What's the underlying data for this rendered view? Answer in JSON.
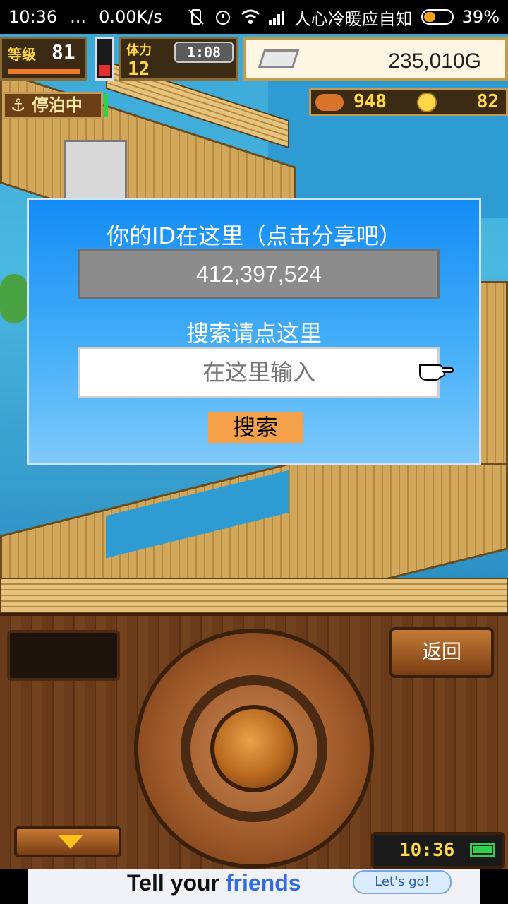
{
  "status_bar": {
    "time": "10:36",
    "dots": "...",
    "net_speed": "0.00K/s",
    "carrier": "人心冷暖应自知",
    "battery": "39%"
  },
  "hud": {
    "level_label": "等级",
    "level_value": "81",
    "stamina_label": "体力",
    "stamina_value": "12",
    "stamina_timer": "1:08",
    "gold": "235,010G",
    "docked_label": "停泊中",
    "food": "948",
    "coins": "82"
  },
  "dialog": {
    "title": "你的ID在这里（点击分享吧）",
    "id_value": "412,397,524",
    "search_label": "搜索请点这里",
    "search_placeholder": "在这里输入",
    "search_button": "搜索"
  },
  "panel": {
    "back_button": "返回",
    "clock": "10:36"
  },
  "ad": {
    "text_part1": "Tell your ",
    "text_part2": "friends",
    "bubble": "Let's go!"
  },
  "colors": {
    "dialog_top": "#148cf5",
    "dialog_bottom": "#7ec9fb",
    "id_box": "#8c8c8c",
    "search_button": "#f5a14a",
    "wood": "#6a3b1a"
  }
}
